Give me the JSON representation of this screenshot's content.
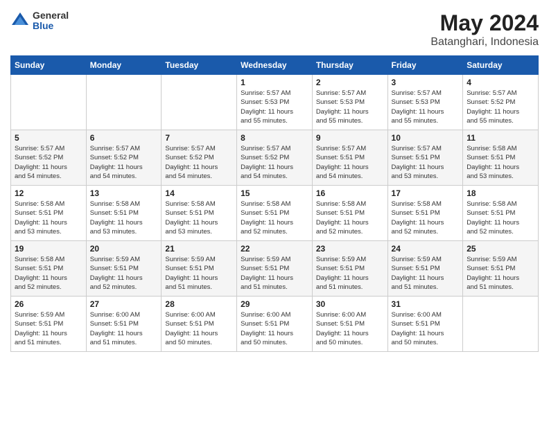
{
  "header": {
    "logo_general": "General",
    "logo_blue": "Blue",
    "title": "May 2024",
    "location": "Batanghari, Indonesia"
  },
  "days_of_week": [
    "Sunday",
    "Monday",
    "Tuesday",
    "Wednesday",
    "Thursday",
    "Friday",
    "Saturday"
  ],
  "weeks": [
    [
      {
        "day": "",
        "info": ""
      },
      {
        "day": "",
        "info": ""
      },
      {
        "day": "",
        "info": ""
      },
      {
        "day": "1",
        "info": "Sunrise: 5:57 AM\nSunset: 5:53 PM\nDaylight: 11 hours\nand 55 minutes."
      },
      {
        "day": "2",
        "info": "Sunrise: 5:57 AM\nSunset: 5:53 PM\nDaylight: 11 hours\nand 55 minutes."
      },
      {
        "day": "3",
        "info": "Sunrise: 5:57 AM\nSunset: 5:53 PM\nDaylight: 11 hours\nand 55 minutes."
      },
      {
        "day": "4",
        "info": "Sunrise: 5:57 AM\nSunset: 5:52 PM\nDaylight: 11 hours\nand 55 minutes."
      }
    ],
    [
      {
        "day": "5",
        "info": "Sunrise: 5:57 AM\nSunset: 5:52 PM\nDaylight: 11 hours\nand 54 minutes."
      },
      {
        "day": "6",
        "info": "Sunrise: 5:57 AM\nSunset: 5:52 PM\nDaylight: 11 hours\nand 54 minutes."
      },
      {
        "day": "7",
        "info": "Sunrise: 5:57 AM\nSunset: 5:52 PM\nDaylight: 11 hours\nand 54 minutes."
      },
      {
        "day": "8",
        "info": "Sunrise: 5:57 AM\nSunset: 5:52 PM\nDaylight: 11 hours\nand 54 minutes."
      },
      {
        "day": "9",
        "info": "Sunrise: 5:57 AM\nSunset: 5:51 PM\nDaylight: 11 hours\nand 54 minutes."
      },
      {
        "day": "10",
        "info": "Sunrise: 5:57 AM\nSunset: 5:51 PM\nDaylight: 11 hours\nand 53 minutes."
      },
      {
        "day": "11",
        "info": "Sunrise: 5:58 AM\nSunset: 5:51 PM\nDaylight: 11 hours\nand 53 minutes."
      }
    ],
    [
      {
        "day": "12",
        "info": "Sunrise: 5:58 AM\nSunset: 5:51 PM\nDaylight: 11 hours\nand 53 minutes."
      },
      {
        "day": "13",
        "info": "Sunrise: 5:58 AM\nSunset: 5:51 PM\nDaylight: 11 hours\nand 53 minutes."
      },
      {
        "day": "14",
        "info": "Sunrise: 5:58 AM\nSunset: 5:51 PM\nDaylight: 11 hours\nand 53 minutes."
      },
      {
        "day": "15",
        "info": "Sunrise: 5:58 AM\nSunset: 5:51 PM\nDaylight: 11 hours\nand 52 minutes."
      },
      {
        "day": "16",
        "info": "Sunrise: 5:58 AM\nSunset: 5:51 PM\nDaylight: 11 hours\nand 52 minutes."
      },
      {
        "day": "17",
        "info": "Sunrise: 5:58 AM\nSunset: 5:51 PM\nDaylight: 11 hours\nand 52 minutes."
      },
      {
        "day": "18",
        "info": "Sunrise: 5:58 AM\nSunset: 5:51 PM\nDaylight: 11 hours\nand 52 minutes."
      }
    ],
    [
      {
        "day": "19",
        "info": "Sunrise: 5:58 AM\nSunset: 5:51 PM\nDaylight: 11 hours\nand 52 minutes."
      },
      {
        "day": "20",
        "info": "Sunrise: 5:59 AM\nSunset: 5:51 PM\nDaylight: 11 hours\nand 52 minutes."
      },
      {
        "day": "21",
        "info": "Sunrise: 5:59 AM\nSunset: 5:51 PM\nDaylight: 11 hours\nand 51 minutes."
      },
      {
        "day": "22",
        "info": "Sunrise: 5:59 AM\nSunset: 5:51 PM\nDaylight: 11 hours\nand 51 minutes."
      },
      {
        "day": "23",
        "info": "Sunrise: 5:59 AM\nSunset: 5:51 PM\nDaylight: 11 hours\nand 51 minutes."
      },
      {
        "day": "24",
        "info": "Sunrise: 5:59 AM\nSunset: 5:51 PM\nDaylight: 11 hours\nand 51 minutes."
      },
      {
        "day": "25",
        "info": "Sunrise: 5:59 AM\nSunset: 5:51 PM\nDaylight: 11 hours\nand 51 minutes."
      }
    ],
    [
      {
        "day": "26",
        "info": "Sunrise: 5:59 AM\nSunset: 5:51 PM\nDaylight: 11 hours\nand 51 minutes."
      },
      {
        "day": "27",
        "info": "Sunrise: 6:00 AM\nSunset: 5:51 PM\nDaylight: 11 hours\nand 51 minutes."
      },
      {
        "day": "28",
        "info": "Sunrise: 6:00 AM\nSunset: 5:51 PM\nDaylight: 11 hours\nand 50 minutes."
      },
      {
        "day": "29",
        "info": "Sunrise: 6:00 AM\nSunset: 5:51 PM\nDaylight: 11 hours\nand 50 minutes."
      },
      {
        "day": "30",
        "info": "Sunrise: 6:00 AM\nSunset: 5:51 PM\nDaylight: 11 hours\nand 50 minutes."
      },
      {
        "day": "31",
        "info": "Sunrise: 6:00 AM\nSunset: 5:51 PM\nDaylight: 11 hours\nand 50 minutes."
      },
      {
        "day": "",
        "info": ""
      }
    ]
  ]
}
